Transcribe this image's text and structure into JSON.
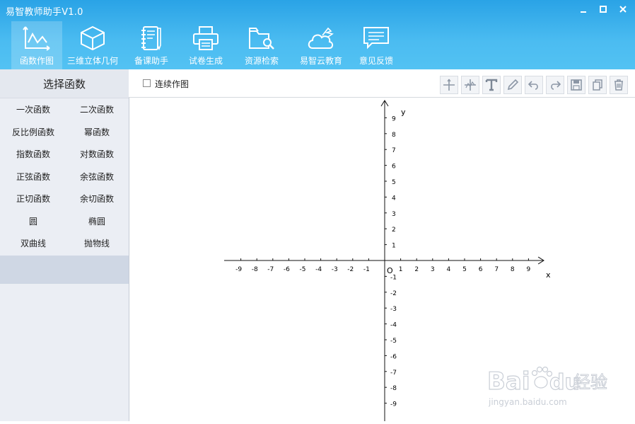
{
  "app": {
    "title": "易智教师助手V1.0"
  },
  "window_controls": {
    "minimize": "–",
    "maximize": "□",
    "close": "✕"
  },
  "nav": [
    {
      "label": "函数作图",
      "icon": "function-graph-icon"
    },
    {
      "label": "三维立体几何",
      "icon": "cube-icon"
    },
    {
      "label": "备课助手",
      "icon": "notebook-icon"
    },
    {
      "label": "试卷生成",
      "icon": "printer-icon"
    },
    {
      "label": "资源检索",
      "icon": "folder-search-icon"
    },
    {
      "label": "易智云教育",
      "icon": "cloud-bird-icon"
    },
    {
      "label": "意见反馈",
      "icon": "chat-icon"
    }
  ],
  "sidebar": {
    "title": "选择函数",
    "items": [
      "一次函数",
      "二次函数",
      "反比例函数",
      "幂函数",
      "指数函数",
      "对数函数",
      "正弦函数",
      "余弦函数",
      "正切函数",
      "余切函数",
      "圆",
      "椭圆",
      "双曲线",
      "抛物线"
    ]
  },
  "toolbar": {
    "continuous_label": "连续作图",
    "continuous_checked": false,
    "tools": [
      "pan-icon",
      "move-axis-icon",
      "text-icon",
      "pencil-icon",
      "undo-icon",
      "redo-icon",
      "save-icon",
      "copy-icon",
      "delete-icon"
    ]
  },
  "graph": {
    "x_axis_label": "x",
    "y_axis_label": "y",
    "origin_label": "O",
    "x_ticks": [
      -9,
      -8,
      -7,
      -6,
      -5,
      -4,
      -3,
      -2,
      -1,
      1,
      2,
      3,
      4,
      5,
      6,
      7,
      8,
      9
    ],
    "y_ticks": [
      9,
      8,
      7,
      6,
      5,
      4,
      3,
      2,
      1,
      -1,
      -2,
      -3,
      -4,
      -5,
      -6,
      -7,
      -8,
      -9
    ]
  },
  "watermark": {
    "brand": "Bai",
    "brand2": "du",
    "product": "经验",
    "url": "jingyan.baidu.com"
  }
}
